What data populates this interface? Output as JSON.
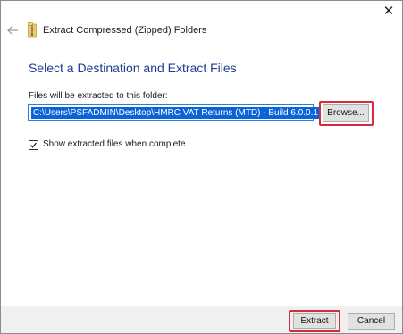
{
  "window": {
    "title": "Extract Compressed (Zipped) Folders",
    "close_glyph": "✕"
  },
  "main": {
    "heading": "Select a Destination and Extract Files",
    "destination_label": "Files will be extracted to this folder:",
    "destination_value": "C:\\Users\\PSFADMIN\\Desktop\\HMRC VAT Returns (MTD) - Build 6.0.0.1",
    "browse_label": "Browse...",
    "show_files_label": "Show extracted files when complete",
    "show_files_checked": true
  },
  "footer": {
    "extract_label": "Extract",
    "cancel_label": "Cancel"
  },
  "colors": {
    "heading": "#1c3c90",
    "highlight_outline": "#d52b3a",
    "selection": "#0a64d8"
  },
  "icons": [
    "close-icon",
    "back-arrow-icon",
    "zip-folder-icon",
    "checkmark-icon"
  ]
}
